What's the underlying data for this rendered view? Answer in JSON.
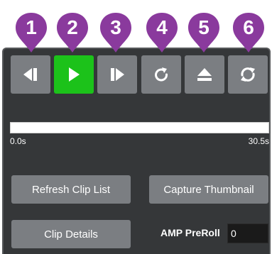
{
  "callouts": [
    "1",
    "2",
    "3",
    "4",
    "5",
    "6"
  ],
  "colors": {
    "callout": "#8a3a9d",
    "panel": "#353739",
    "button": "#7b7e82",
    "active_button": "#1cc21a",
    "timeline": "#ffffff"
  },
  "transport": {
    "buttons": [
      {
        "icon": "step-back-icon",
        "active": false
      },
      {
        "icon": "play-icon",
        "active": true
      },
      {
        "icon": "step-forward-icon",
        "active": false
      },
      {
        "icon": "loop-icon",
        "active": false
      },
      {
        "icon": "eject-icon",
        "active": false
      },
      {
        "icon": "refresh-icon",
        "active": false
      }
    ]
  },
  "timeline": {
    "start_label": "0.0s",
    "end_label": "30.5s",
    "progress": 0
  },
  "actions": {
    "refresh_clip_list": "Refresh Clip List",
    "capture_thumbnail": "Capture Thumbnail",
    "clip_details": "Clip Details"
  },
  "amp_preroll": {
    "label": "AMP PreRoll",
    "value": "0"
  }
}
